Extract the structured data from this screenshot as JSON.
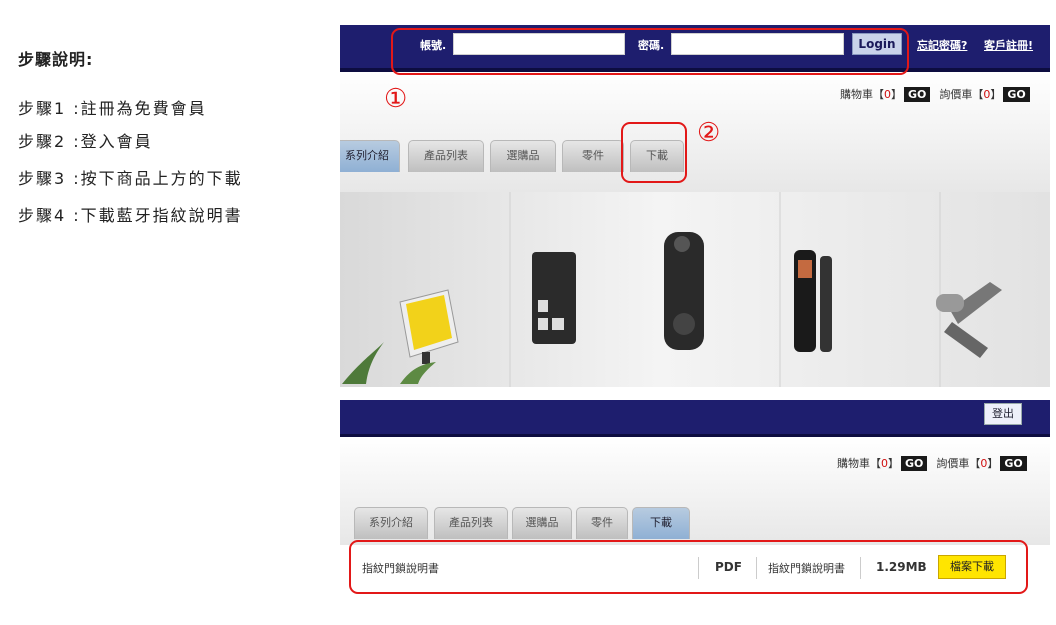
{
  "instructions": {
    "title": "步驟說明:",
    "steps": [
      "步驟1 :註冊為免費會員",
      "步驟2 :登入會員",
      "步驟3 :按下商品上方的下載",
      "步驟4 :下載藍牙指紋說明書"
    ]
  },
  "header": {
    "account_label": "帳號.",
    "password_label": "密碼.",
    "account_value": "",
    "password_value": "",
    "login_button": "Login",
    "forgot_password": "忘記密碼?",
    "register": "客戶註冊!"
  },
  "cart": {
    "cart_label": "購物車【",
    "cart_count": "0",
    "close": "】",
    "go": "GO",
    "inquiry_label": "詢價車【",
    "inquiry_count": "0"
  },
  "tabs": [
    "系列介紹",
    "產品列表",
    "選購品",
    "零件",
    "下載"
  ],
  "callouts": {
    "one": "①",
    "two": "②"
  },
  "nav2": {
    "logout": "登出"
  },
  "download_row": {
    "name": "指紋門鎖說明書",
    "type": "PDF",
    "description": "指紋門鎖說明書",
    "size": "1.29MB",
    "button": "檔案下載"
  },
  "colors": {
    "navy": "#1e1e6e",
    "callout_red": "#e21818",
    "download_yellow": "#ffe500",
    "active_tab": "#9fbcd9"
  }
}
